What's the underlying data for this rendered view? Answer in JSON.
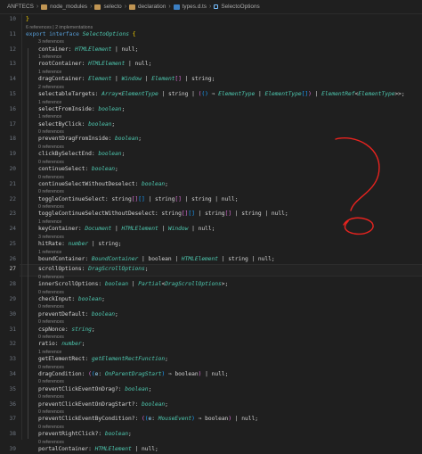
{
  "breadcrumb": {
    "segments": [
      "ANFTECS",
      "node_modules",
      "selecto",
      "declaration",
      "types.d.ts",
      "SelectoOptions"
    ]
  },
  "colors": {
    "background": "#1f1f1f",
    "keyword": "#569cd6",
    "type": "#4ec9b0",
    "bracket_gold": "#ffd700",
    "bracket_purple": "#da70d6",
    "bracket_blue": "#179fff",
    "annotation": "#e8231f"
  },
  "editor": {
    "active_line": "27",
    "lines": [
      {
        "n": "10",
        "lens": "",
        "tokens": [
          {
            "c": "t-bk",
            "t": "}"
          }
        ]
      },
      {
        "n": "11",
        "lens": "6 references | 2 implementations",
        "tokens": [
          {
            "c": "t-kw",
            "t": "export interface "
          },
          {
            "c": "t-type",
            "t": "SelectoOptions"
          },
          {
            "c": "t-pun",
            "t": " "
          },
          {
            "c": "t-bk",
            "t": "{"
          }
        ]
      },
      {
        "n": "12",
        "lens": "3 references",
        "tokens": [
          {
            "c": "t-id",
            "t": "container: "
          },
          {
            "c": "t-type",
            "t": "HTMLElement"
          },
          {
            "c": "t-pun",
            "t": " | null;"
          }
        ]
      },
      {
        "n": "13",
        "lens": "1 reference",
        "tokens": [
          {
            "c": "t-id",
            "t": "rootContainer: "
          },
          {
            "c": "t-type",
            "t": "HTMLElement"
          },
          {
            "c": "t-pun",
            "t": " | null;"
          }
        ]
      },
      {
        "n": "14",
        "lens": "1 reference",
        "tokens": [
          {
            "c": "t-id",
            "t": "dragContainer: "
          },
          {
            "c": "t-type",
            "t": "Element"
          },
          {
            "c": "t-pun",
            "t": " | "
          },
          {
            "c": "t-type",
            "t": "Window"
          },
          {
            "c": "t-pun",
            "t": " | "
          },
          {
            "c": "t-type",
            "t": "Element"
          },
          {
            "c": "t-bk2",
            "t": "[]"
          },
          {
            "c": "t-pun",
            "t": " | string;"
          }
        ]
      },
      {
        "n": "15",
        "lens": "2 references",
        "tokens": [
          {
            "c": "t-id",
            "t": "selectableTargets: "
          },
          {
            "c": "t-type",
            "t": "Array"
          },
          {
            "c": "t-pun",
            "t": "<"
          },
          {
            "c": "t-type",
            "t": "ElementType"
          },
          {
            "c": "t-pun",
            "t": " | string | "
          },
          {
            "c": "t-bk2",
            "t": "("
          },
          {
            "c": "t-bk3",
            "t": "()"
          },
          {
            "c": "t-pun",
            "t": " ⇒ "
          },
          {
            "c": "t-type",
            "t": "ElementType"
          },
          {
            "c": "t-pun",
            "t": " | "
          },
          {
            "c": "t-type",
            "t": "ElementType"
          },
          {
            "c": "t-bk3",
            "t": "[]"
          },
          {
            "c": "t-bk2",
            "t": ")"
          },
          {
            "c": "t-pun",
            "t": " | "
          },
          {
            "c": "t-type",
            "t": "ElementRef"
          },
          {
            "c": "t-pun",
            "t": "<"
          },
          {
            "c": "t-type",
            "t": "ElementType"
          },
          {
            "c": "t-pun",
            "t": ">>;"
          }
        ]
      },
      {
        "n": "16",
        "lens": "1 reference",
        "tokens": [
          {
            "c": "t-id",
            "t": "selectFromInside: "
          },
          {
            "c": "t-type",
            "t": "boolean"
          },
          {
            "c": "t-pun",
            "t": ";"
          }
        ]
      },
      {
        "n": "17",
        "lens": "1 reference",
        "tokens": [
          {
            "c": "t-id",
            "t": "selectByClick: "
          },
          {
            "c": "t-type",
            "t": "boolean"
          },
          {
            "c": "t-pun",
            "t": ";"
          }
        ]
      },
      {
        "n": "18",
        "lens": "0 references",
        "tokens": [
          {
            "c": "t-id",
            "t": "preventDragFromInside: "
          },
          {
            "c": "t-type",
            "t": "boolean"
          },
          {
            "c": "t-pun",
            "t": ";"
          }
        ]
      },
      {
        "n": "19",
        "lens": "0 references",
        "tokens": [
          {
            "c": "t-id",
            "t": "clickBySelectEnd: "
          },
          {
            "c": "t-type",
            "t": "boolean"
          },
          {
            "c": "t-pun",
            "t": ";"
          }
        ]
      },
      {
        "n": "20",
        "lens": "0 references",
        "tokens": [
          {
            "c": "t-id",
            "t": "continueSelect: "
          },
          {
            "c": "t-type",
            "t": "boolean"
          },
          {
            "c": "t-pun",
            "t": ";"
          }
        ]
      },
      {
        "n": "21",
        "lens": "0 references",
        "tokens": [
          {
            "c": "t-id",
            "t": "continueSelectWithoutDeselect: "
          },
          {
            "c": "t-type",
            "t": "boolean"
          },
          {
            "c": "t-pun",
            "t": ";"
          }
        ]
      },
      {
        "n": "22",
        "lens": "0 references",
        "tokens": [
          {
            "c": "t-id",
            "t": "toggleContinueSelect: "
          },
          {
            "c": "t-pun",
            "t": "string"
          },
          {
            "c": "t-bk2",
            "t": "[]"
          },
          {
            "c": "t-bk3",
            "t": "[]"
          },
          {
            "c": "t-pun",
            "t": " | string"
          },
          {
            "c": "t-bk2",
            "t": "[]"
          },
          {
            "c": "t-pun",
            "t": " | string | null;"
          }
        ]
      },
      {
        "n": "23",
        "lens": "0 references",
        "tokens": [
          {
            "c": "t-id",
            "t": "toggleContinueSelectWithoutDeselect: "
          },
          {
            "c": "t-pun",
            "t": "string"
          },
          {
            "c": "t-bk2",
            "t": "[]"
          },
          {
            "c": "t-bk3",
            "t": "[]"
          },
          {
            "c": "t-pun",
            "t": " | string"
          },
          {
            "c": "t-bk2",
            "t": "[]"
          },
          {
            "c": "t-pun",
            "t": " | string | null;"
          }
        ]
      },
      {
        "n": "24",
        "lens": "1 reference",
        "tokens": [
          {
            "c": "t-id",
            "t": "keyContainer: "
          },
          {
            "c": "t-type",
            "t": "Document"
          },
          {
            "c": "t-pun",
            "t": " | "
          },
          {
            "c": "t-type",
            "t": "HTMLElement"
          },
          {
            "c": "t-pun",
            "t": " | "
          },
          {
            "c": "t-type",
            "t": "Window"
          },
          {
            "c": "t-pun",
            "t": " | null;"
          }
        ]
      },
      {
        "n": "25",
        "lens": "3 references",
        "tokens": [
          {
            "c": "t-id",
            "t": "hitRate: "
          },
          {
            "c": "t-type",
            "t": "number"
          },
          {
            "c": "t-pun",
            "t": " | string;"
          }
        ]
      },
      {
        "n": "26",
        "lens": "1 reference",
        "tokens": [
          {
            "c": "t-id",
            "t": "boundContainer: "
          },
          {
            "c": "t-type",
            "t": "BoundContainer"
          },
          {
            "c": "t-pun",
            "t": " | boolean | "
          },
          {
            "c": "t-type",
            "t": "HTMLElement"
          },
          {
            "c": "t-pun",
            "t": " | string | null;"
          }
        ]
      },
      {
        "n": "27",
        "lens": "",
        "tokens": [
          {
            "c": "t-id",
            "t": "scrollOptions: "
          },
          {
            "c": "t-type",
            "t": "DragScrollOptions"
          },
          {
            "c": "t-pun",
            "t": ";"
          }
        ]
      },
      {
        "n": "28",
        "lens": "0 references",
        "tokens": [
          {
            "c": "t-id",
            "t": "innerScrollOptions: "
          },
          {
            "c": "t-type",
            "t": "boolean"
          },
          {
            "c": "t-pun",
            "t": " | "
          },
          {
            "c": "t-type",
            "t": "Partial"
          },
          {
            "c": "t-pun",
            "t": "<"
          },
          {
            "c": "t-type",
            "t": "DragScrollOptions"
          },
          {
            "c": "t-pun",
            "t": ">;"
          }
        ]
      },
      {
        "n": "29",
        "lens": "0 references",
        "tokens": [
          {
            "c": "t-id",
            "t": "checkInput: "
          },
          {
            "c": "t-type",
            "t": "boolean"
          },
          {
            "c": "t-pun",
            "t": ";"
          }
        ]
      },
      {
        "n": "30",
        "lens": "0 references",
        "tokens": [
          {
            "c": "t-id",
            "t": "preventDefault: "
          },
          {
            "c": "t-type",
            "t": "boolean"
          },
          {
            "c": "t-pun",
            "t": ";"
          }
        ]
      },
      {
        "n": "31",
        "lens": "0 references",
        "tokens": [
          {
            "c": "t-id",
            "t": "cspNonce: "
          },
          {
            "c": "t-type",
            "t": "string"
          },
          {
            "c": "t-pun",
            "t": ";"
          }
        ]
      },
      {
        "n": "32",
        "lens": "0 references",
        "tokens": [
          {
            "c": "t-id",
            "t": "ratio: "
          },
          {
            "c": "t-type",
            "t": "number"
          },
          {
            "c": "t-pun",
            "t": ";"
          }
        ]
      },
      {
        "n": "33",
        "lens": "1 reference",
        "tokens": [
          {
            "c": "t-id",
            "t": "getElementRect: "
          },
          {
            "c": "t-type",
            "t": "getElementRectFunction"
          },
          {
            "c": "t-pun",
            "t": ";"
          }
        ]
      },
      {
        "n": "34",
        "lens": "0 references",
        "tokens": [
          {
            "c": "t-id",
            "t": "dragCondition: "
          },
          {
            "c": "t-bk2",
            "t": "("
          },
          {
            "c": "t-bk3",
            "t": "("
          },
          {
            "c": "t-var",
            "t": "e"
          },
          {
            "c": "t-pun",
            "t": ": "
          },
          {
            "c": "t-type",
            "t": "OnParentDragStart"
          },
          {
            "c": "t-bk3",
            "t": ")"
          },
          {
            "c": "t-pun",
            "t": " ⇒ boolean"
          },
          {
            "c": "t-bk2",
            "t": ")"
          },
          {
            "c": "t-pun",
            "t": " | null;"
          }
        ]
      },
      {
        "n": "35",
        "lens": "0 references",
        "tokens": [
          {
            "c": "t-id",
            "t": "preventClickEventOnDrag?: "
          },
          {
            "c": "t-type",
            "t": "boolean"
          },
          {
            "c": "t-pun",
            "t": ";"
          }
        ]
      },
      {
        "n": "36",
        "lens": "0 references",
        "tokens": [
          {
            "c": "t-id",
            "t": "preventClickEventOnDragStart?: "
          },
          {
            "c": "t-type",
            "t": "boolean"
          },
          {
            "c": "t-pun",
            "t": ";"
          }
        ]
      },
      {
        "n": "37",
        "lens": "0 references",
        "tokens": [
          {
            "c": "t-id",
            "t": "preventClickEventByCondition?: "
          },
          {
            "c": "t-bk2",
            "t": "("
          },
          {
            "c": "t-bk3",
            "t": "("
          },
          {
            "c": "t-var",
            "t": "e"
          },
          {
            "c": "t-pun",
            "t": ": "
          },
          {
            "c": "t-type",
            "t": "MouseEvent"
          },
          {
            "c": "t-bk3",
            "t": ")"
          },
          {
            "c": "t-pun",
            "t": " ⇒ boolean"
          },
          {
            "c": "t-bk2",
            "t": ")"
          },
          {
            "c": "t-pun",
            "t": " | null;"
          }
        ]
      },
      {
        "n": "38",
        "lens": "0 references",
        "tokens": [
          {
            "c": "t-id",
            "t": "preventRightClick?: "
          },
          {
            "c": "t-type",
            "t": "boolean"
          },
          {
            "c": "t-pun",
            "t": ";"
          }
        ]
      },
      {
        "n": "39",
        "lens": "0 references",
        "tokens": [
          {
            "c": "t-id",
            "t": "portalContainer: "
          },
          {
            "c": "t-type",
            "t": "HTMLElement"
          },
          {
            "c": "t-pun",
            "t": " | null;"
          }
        ]
      }
    ]
  }
}
